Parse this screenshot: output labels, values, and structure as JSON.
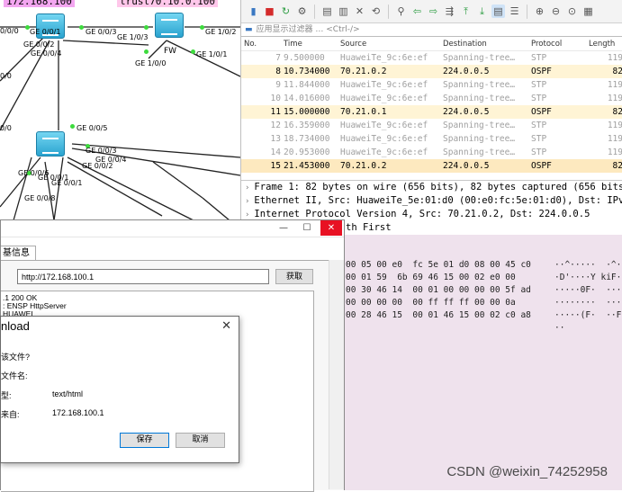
{
  "topology": {
    "zone_left": "172.168.100",
    "zone_right": "trust70.10.0.100",
    "fw_label": "FW",
    "port_labels": [
      "0/0/0",
      "GE 0/0/1",
      "GE 0/0/2",
      "GE 0/0/4",
      "0/0",
      "GE 0/0/3",
      "GE 1/0/3",
      "GE 1/0/0",
      "GE 1/0/2",
      "GE 1/0/1",
      "GE 0/0/5",
      "0/0",
      "GE 0/0/3",
      "GE 0/0/4",
      "GE 0/0/2",
      "GE 0/0/6",
      "GE 0/0/1",
      "GE 0/0/8",
      "GE 0/0/1"
    ],
    "colors": {
      "zone_left": "#f3a6f0",
      "zone_right": "#ffc7ea",
      "link_dot": "#3ddb3d"
    }
  },
  "wireshark": {
    "toolbar_icons": [
      "red-square-icon",
      "refresh-icon",
      "gear-icon",
      "open-icon",
      "save-icon",
      "close-file-icon",
      "reload-icon",
      "find-icon",
      "back-icon",
      "forward-icon",
      "goto-icon",
      "first-icon",
      "last-icon",
      "autoscroll-icon",
      "colorize-icon",
      "zoom-in-icon",
      "zoom-out-icon",
      "zoom-reset-icon",
      "resize-columns-icon"
    ],
    "filter_placeholder": "应用显示过滤器 … <Ctrl-/>",
    "columns": [
      "No.",
      "Time",
      "Source",
      "Destination",
      "Protocol",
      "Length"
    ],
    "packets": [
      {
        "no": "7",
        "time": "9.500000",
        "src": "HuaweiTe_9c:6e:ef",
        "dst": "Spanning-tree…",
        "proto": "STP",
        "len": "119",
        "style": "gray"
      },
      {
        "no": "8",
        "time": "10.734000",
        "src": "70.21.0.2",
        "dst": "224.0.0.5",
        "proto": "OSPF",
        "len": "82",
        "style": "yellow"
      },
      {
        "no": "9",
        "time": "11.844000",
        "src": "HuaweiTe_9c:6e:ef",
        "dst": "Spanning-tree…",
        "proto": "STP",
        "len": "119",
        "style": "gray"
      },
      {
        "no": "10",
        "time": "14.016000",
        "src": "HuaweiTe_9c:6e:ef",
        "dst": "Spanning-tree…",
        "proto": "STP",
        "len": "119",
        "style": "gray"
      },
      {
        "no": "11",
        "time": "15.000000",
        "src": "70.21.0.1",
        "dst": "224.0.0.5",
        "proto": "OSPF",
        "len": "82",
        "style": "yellow"
      },
      {
        "no": "12",
        "time": "16.359000",
        "src": "HuaweiTe_9c:6e:ef",
        "dst": "Spanning-tree…",
        "proto": "STP",
        "len": "119",
        "style": "gray"
      },
      {
        "no": "13",
        "time": "18.734000",
        "src": "HuaweiTe_9c:6e:ef",
        "dst": "Spanning-tree…",
        "proto": "STP",
        "len": "119",
        "style": "gray"
      },
      {
        "no": "14",
        "time": "20.953000",
        "src": "HuaweiTe_9c:6e:ef",
        "dst": "Spanning-tree…",
        "proto": "STP",
        "len": "119",
        "style": "gray"
      },
      {
        "no": "15",
        "time": "21.453000",
        "src": "70.21.0.2",
        "dst": "224.0.0.5",
        "proto": "OSPF",
        "len": "82",
        "style": "sel"
      }
    ],
    "details": [
      "Frame 1: 82 bytes on wire (656 bits), 82 bytes captured (656 bits)",
      "Ethernet II, Src: HuaweiTe_5e:01:d0 (00:e0:fc:5e:01:d0), Dst: IPv4",
      "Internet Protocol Version 4, Src: 70.21.0.2, Dst: 224.0.0.5",
      "th First"
    ],
    "hex": [
      {
        "bytes": "00 05 00 e0  fc 5e 01 d0 08 00 45 c0",
        "ascii": "··^·····  ·^····E·"
      },
      {
        "bytes": "00 01 59  6b 69 46 15 00 02 e0 00",
        "ascii": "·D'····Y kiF·····"
      },
      {
        "bytes": "00 30 46 14  00 01 00 00 00 00 5f ad",
        "ascii": "·····0F·  ······_·"
      },
      {
        "bytes": "00 00 00 00  00 ff ff ff 00 00 0a",
        "ascii": "········  ········"
      },
      {
        "bytes": "00 28 46 15  00 01 46 15 00 02 c0 a8",
        "ascii": "·····(F·  ··F·····"
      },
      {
        "bytes": "",
        "ascii": "··"
      }
    ]
  },
  "http_client": {
    "window_buttons": [
      "—",
      "☐",
      "✕"
    ],
    "tab_label": "基信息",
    "url_value": "http://172.168.100.1",
    "fetch_label": "获取",
    "response_lines": [
      ".1 200 OK",
      ": ENSP HttpServer",
      "HUAWEI"
    ]
  },
  "download_dialog": {
    "title": "nload",
    "close_glyph": "✕",
    "question": "该文件?",
    "rows": [
      {
        "label": "文件名:",
        "value": ""
      },
      {
        "label": "型:",
        "value": "text/html"
      },
      {
        "label": "来自:",
        "value": "172.168.100.1"
      }
    ],
    "save_label": "保存",
    "cancel_label": "取消"
  },
  "watermark": "CSDN @weixin_74252958"
}
